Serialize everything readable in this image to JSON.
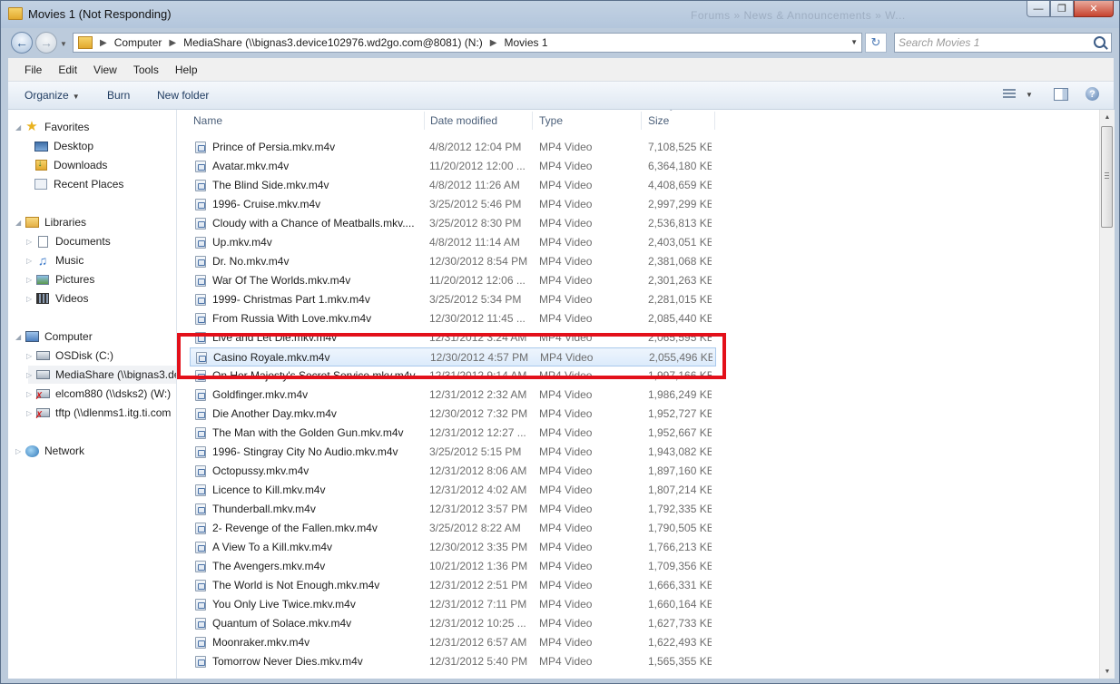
{
  "window": {
    "title": "Movies 1 (Not Responding)",
    "ghost_text": "Forums  »  News & Announcements  »  W..."
  },
  "address": {
    "crumbs": [
      "Computer",
      "MediaShare (\\\\bignas3.device102976.wd2go.com@8081) (N:)",
      "Movies 1"
    ],
    "search_placeholder": "Search Movies 1"
  },
  "menu": [
    "File",
    "Edit",
    "View",
    "Tools",
    "Help"
  ],
  "commands": {
    "organize": "Organize",
    "burn": "Burn",
    "new_folder": "New folder"
  },
  "nav": {
    "favorites": {
      "label": "Favorites",
      "items": [
        "Desktop",
        "Downloads",
        "Recent Places"
      ]
    },
    "libraries": {
      "label": "Libraries",
      "items": [
        "Documents",
        "Music",
        "Pictures",
        "Videos"
      ]
    },
    "computer": {
      "label": "Computer",
      "items": [
        "OSDisk (C:)",
        "MediaShare (\\\\bignas3.de",
        "elcom880 (\\\\dsks2) (W:)",
        "tftp (\\\\dlenms1.itg.ti.com"
      ]
    },
    "network": {
      "label": "Network"
    }
  },
  "columns": {
    "name": "Name",
    "date": "Date modified",
    "type": "Type",
    "size": "Size"
  },
  "files": [
    {
      "name": "Prince of Persia.mkv.m4v",
      "date": "4/8/2012 12:04 PM",
      "type": "MP4 Video",
      "size": "7,108,525 KB"
    },
    {
      "name": "Avatar.mkv.m4v",
      "date": "11/20/2012 12:00 ...",
      "type": "MP4 Video",
      "size": "6,364,180 KB"
    },
    {
      "name": "The Blind Side.mkv.m4v",
      "date": "4/8/2012 11:26 AM",
      "type": "MP4 Video",
      "size": "4,408,659 KB"
    },
    {
      "name": "1996- Cruise.mkv.m4v",
      "date": "3/25/2012 5:46 PM",
      "type": "MP4 Video",
      "size": "2,997,299 KB"
    },
    {
      "name": "Cloudy with a Chance of Meatballs.mkv....",
      "date": "3/25/2012 8:30 PM",
      "type": "MP4 Video",
      "size": "2,536,813 KB"
    },
    {
      "name": "Up.mkv.m4v",
      "date": "4/8/2012 11:14 AM",
      "type": "MP4 Video",
      "size": "2,403,051 KB"
    },
    {
      "name": "Dr. No.mkv.m4v",
      "date": "12/30/2012 8:54 PM",
      "type": "MP4 Video",
      "size": "2,381,068 KB"
    },
    {
      "name": "War Of The Worlds.mkv.m4v",
      "date": "11/20/2012 12:06 ...",
      "type": "MP4 Video",
      "size": "2,301,263 KB"
    },
    {
      "name": "1999- Christmas Part 1.mkv.m4v",
      "date": "3/25/2012 5:34 PM",
      "type": "MP4 Video",
      "size": "2,281,015 KB"
    },
    {
      "name": "From Russia With Love.mkv.m4v",
      "date": "12/30/2012 11:45 ...",
      "type": "MP4 Video",
      "size": "2,085,440 KB"
    },
    {
      "name": "Live and Let Die.mkv.m4v",
      "date": "12/31/2012 3:24 AM",
      "type": "MP4 Video",
      "size": "2,065,595 KB"
    },
    {
      "name": "Casino Royale.mkv.m4v",
      "date": "12/30/2012 4:57 PM",
      "type": "MP4 Video",
      "size": "2,055,496 KB",
      "selected": true
    },
    {
      "name": "On Her Majesty's Secret Service.mkv.m4v",
      "date": "12/31/2012 9:14 AM",
      "type": "MP4 Video",
      "size": "1,997,166 KB"
    },
    {
      "name": "Goldfinger.mkv.m4v",
      "date": "12/31/2012 2:32 AM",
      "type": "MP4 Video",
      "size": "1,986,249 KB"
    },
    {
      "name": "Die Another Day.mkv.m4v",
      "date": "12/30/2012 7:32 PM",
      "type": "MP4 Video",
      "size": "1,952,727 KB"
    },
    {
      "name": "The Man with the Golden Gun.mkv.m4v",
      "date": "12/31/2012 12:27 ...",
      "type": "MP4 Video",
      "size": "1,952,667 KB"
    },
    {
      "name": "1996- Stingray City No Audio.mkv.m4v",
      "date": "3/25/2012 5:15 PM",
      "type": "MP4 Video",
      "size": "1,943,082 KB"
    },
    {
      "name": "Octopussy.mkv.m4v",
      "date": "12/31/2012 8:06 AM",
      "type": "MP4 Video",
      "size": "1,897,160 KB"
    },
    {
      "name": "Licence to Kill.mkv.m4v",
      "date": "12/31/2012 4:02 AM",
      "type": "MP4 Video",
      "size": "1,807,214 KB"
    },
    {
      "name": "Thunderball.mkv.m4v",
      "date": "12/31/2012 3:57 PM",
      "type": "MP4 Video",
      "size": "1,792,335 KB"
    },
    {
      "name": "2- Revenge of the Fallen.mkv.m4v",
      "date": "3/25/2012 8:22 AM",
      "type": "MP4 Video",
      "size": "1,790,505 KB"
    },
    {
      "name": "A View To a Kill.mkv.m4v",
      "date": "12/30/2012 3:35 PM",
      "type": "MP4 Video",
      "size": "1,766,213 KB"
    },
    {
      "name": "The Avengers.mkv.m4v",
      "date": "10/21/2012 1:36 PM",
      "type": "MP4 Video",
      "size": "1,709,356 KB"
    },
    {
      "name": "The World is Not Enough.mkv.m4v",
      "date": "12/31/2012 2:51 PM",
      "type": "MP4 Video",
      "size": "1,666,331 KB"
    },
    {
      "name": "You Only Live Twice.mkv.m4v",
      "date": "12/31/2012 7:11 PM",
      "type": "MP4 Video",
      "size": "1,660,164 KB"
    },
    {
      "name": "Quantum of Solace.mkv.m4v",
      "date": "12/31/2012 10:25 ...",
      "type": "MP4 Video",
      "size": "1,627,733 KB"
    },
    {
      "name": "Moonraker.mkv.m4v",
      "date": "12/31/2012 6:57 AM",
      "type": "MP4 Video",
      "size": "1,622,493 KB"
    },
    {
      "name": "Tomorrow Never Dies.mkv.m4v",
      "date": "12/31/2012 5:40 PM",
      "type": "MP4 Video",
      "size": "1,565,355 KB"
    }
  ],
  "annotation": {
    "color": "#e3101a"
  }
}
